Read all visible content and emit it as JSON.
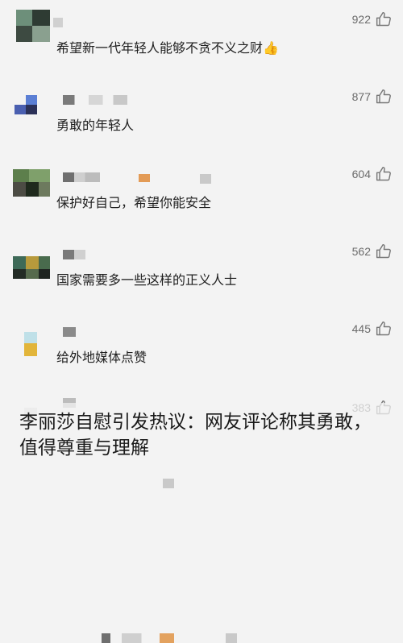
{
  "comments": [
    {
      "text": "希望新一代年轻人能够不贪不义之财",
      "emoji": "👍",
      "likes": "922"
    },
    {
      "text": "勇敢的年轻人",
      "likes": "877"
    },
    {
      "text": "保护好自己，希望你能安全",
      "likes": "604"
    },
    {
      "text": "国家需要多一些这样的正义人士",
      "likes": "562"
    },
    {
      "text": "给外地媒体点赞",
      "likes": "445"
    },
    {
      "text": "",
      "likes": "383"
    }
  ],
  "caption": {
    "line1": "李丽莎自慰引发热议：网友评论称其勇敢，",
    "line2": "值得尊重与理解"
  },
  "icons": {
    "like": "thumb-up-outline-icon"
  },
  "colors": {
    "background": "#f3f3f3",
    "text": "#1f1f1f",
    "count": "#6b6b6b"
  }
}
